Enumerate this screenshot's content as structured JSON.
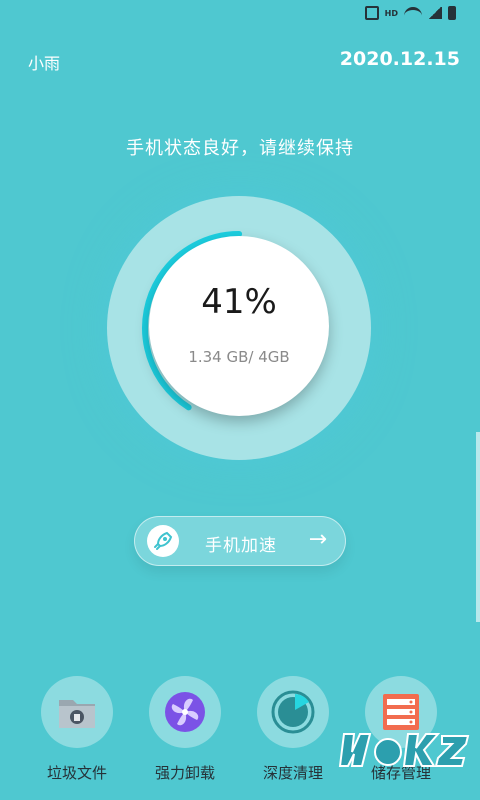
{
  "header": {
    "user": "小雨",
    "date": "2020.12.15"
  },
  "status_bar": {
    "hd": "HD"
  },
  "status_message": "手机状态良好，请继续保持",
  "gauge": {
    "percent_text": "41%",
    "usage_text": "1.34 GB/ 4GB",
    "used_fraction": 0.41,
    "accent": "#1ccfe0",
    "outer_ring": "#a8e3e6"
  },
  "boost": {
    "label": "手机加速",
    "icon": "rocket-icon"
  },
  "tools": [
    {
      "label": "垃圾文件",
      "icon": "trash-folder-icon"
    },
    {
      "label": "强力卸载",
      "icon": "fan-icon"
    },
    {
      "label": "深度清理",
      "icon": "pie-gauge-icon"
    },
    {
      "label": "储存管理",
      "icon": "server-storage-icon"
    }
  ],
  "colors": {
    "background": "#4fc8d0",
    "storage_icon": "#f26c4f",
    "fan_icon": "#7b52e6",
    "gauge_icon": "#2a8e95"
  }
}
